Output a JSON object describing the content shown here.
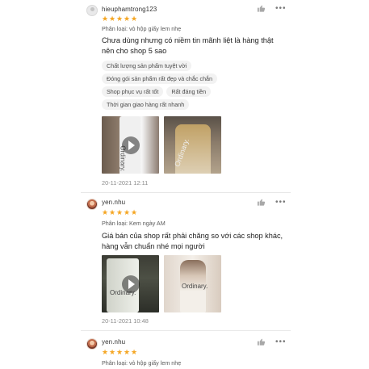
{
  "reviews": [
    {
      "username": "hieuphamtrong123",
      "rating": 5,
      "variant": "Phân loại: vỏ hộp giấy lem nhẹ",
      "comment_lines": [
        "Chưa  dùng nhưng có niềm tin mãnh liệt là hàng thật",
        "nên cho shop 5 sao"
      ],
      "tags": [
        "Chất lượng sản phẩm tuyệt vời",
        "Đóng gói sản phẩm rất đẹp và chắc chắn",
        "Shop phục vụ rất tốt",
        "Rất đáng tiền",
        "Thời gian giao hàng rất nhanh"
      ],
      "date": "20-11-2021 12:11",
      "media": [
        {
          "type": "video",
          "brand": "Ordinary."
        },
        {
          "type": "image",
          "brand": "Ordinary."
        }
      ]
    },
    {
      "username": "yen.nhu",
      "rating": 5,
      "variant": "Phân loại: Kem ngày AM",
      "comment_lines": [
        "Giá bán của shop rất phải chăng so với các shop khác,",
        "hàng vẫn chuẩn nhé mọi người"
      ],
      "date": "20-11-2021 10:48",
      "media": [
        {
          "type": "video",
          "brand": "Ordinary."
        },
        {
          "type": "image",
          "brand": "Ordinary."
        }
      ]
    },
    {
      "username": "yen.nhu",
      "rating": 5,
      "variant": "Phân loại: vỏ hộp giấy lem nhẹ"
    }
  ],
  "icons": {
    "like": "thumbs-up-icon",
    "more": "more-dots-icon",
    "star": "star-icon",
    "play": "play-icon"
  },
  "colors": {
    "star": "#f5a623",
    "divider": "#e8e8e8"
  },
  "more_glyph": "•••",
  "star_glyph": "★"
}
